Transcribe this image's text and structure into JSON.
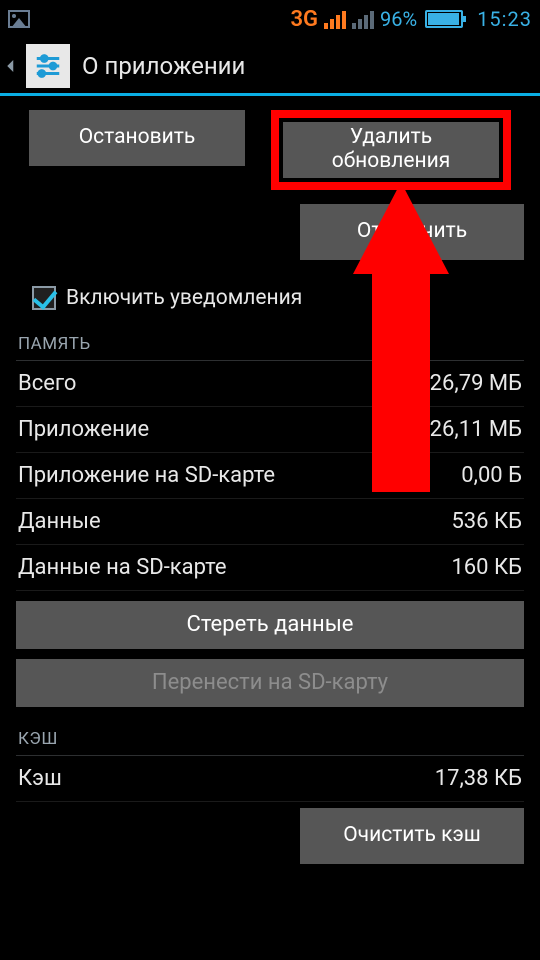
{
  "status": {
    "network_type": "3G",
    "battery_pct": "96%",
    "time": "15:23"
  },
  "title": "О приложении",
  "buttons": {
    "stop": "Остановить",
    "delete_updates": "Удалить обновления",
    "disable": "Отключить",
    "clear_data": "Стереть данные",
    "move_sd": "Перенести на SD-карту",
    "clear_cache": "Очистить кэш"
  },
  "notifications_label": "Включить уведомления",
  "sections": {
    "storage": "ПАМЯТЬ",
    "cache": "КЭШ"
  },
  "storage": {
    "total_label": "Всего",
    "total_val": "26,79 МБ",
    "app_label": "Приложение",
    "app_val": "26,11 МБ",
    "sd_app_label": "Приложение на SD-карте",
    "sd_app_val": "0,00 Б",
    "data_label": "Данные",
    "data_val": "536 КБ",
    "sd_data_label": "Данные на SD-карте",
    "sd_data_val": "160 КБ"
  },
  "cache": {
    "label": "Кэш",
    "val": "17,38 КБ"
  }
}
